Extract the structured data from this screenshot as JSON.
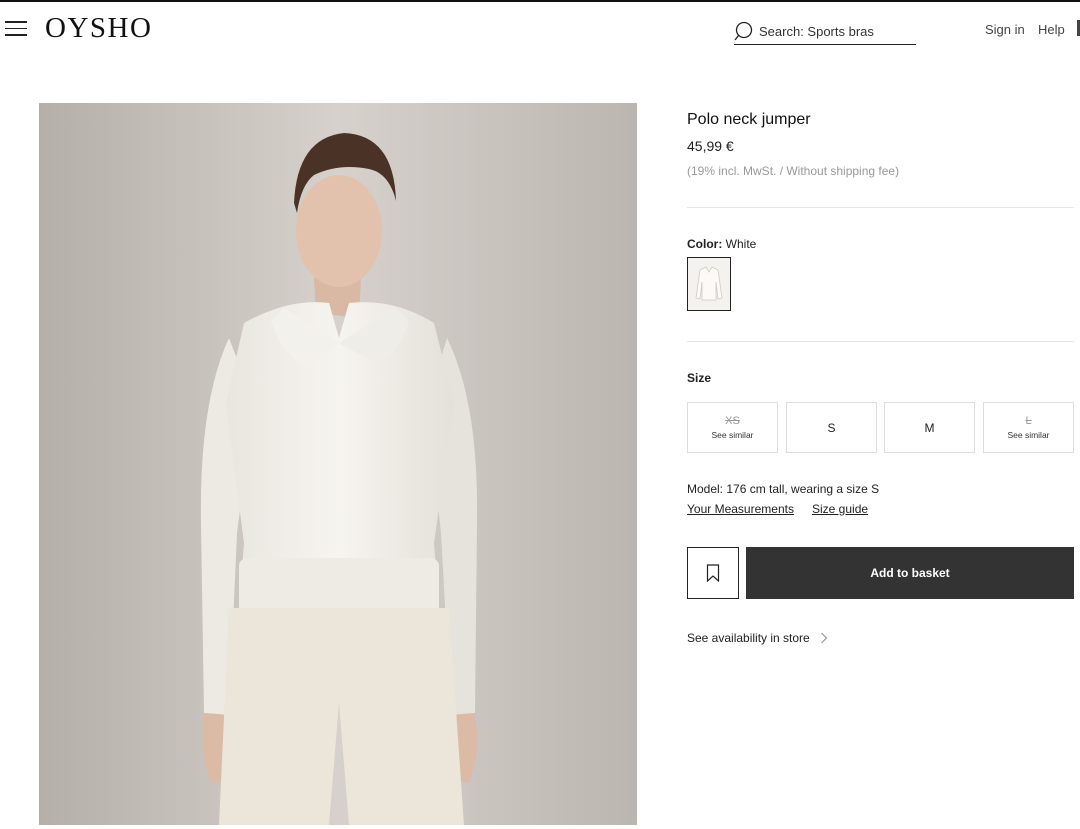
{
  "header": {
    "logo": "OYSHO",
    "search_label": "Search: Sports bras",
    "signin": "Sign in",
    "help": "Help"
  },
  "product": {
    "title": "Polo neck jumper",
    "price": "45,99 €",
    "tax_note": "(19% incl. MwSt. / Without shipping fee)",
    "color_label": "Color:",
    "color_value": "White",
    "size_label": "Size",
    "sizes": [
      {
        "label": "XS",
        "available": false,
        "note": "See similar"
      },
      {
        "label": "S",
        "available": true,
        "note": ""
      },
      {
        "label": "M",
        "available": true,
        "note": ""
      },
      {
        "label": "L",
        "available": false,
        "note": "See similar"
      }
    ],
    "model_info": "Model: 176 cm tall, wearing a size S",
    "your_measurements": "Your Measurements",
    "size_guide": "Size guide",
    "add_to_basket": "Add to basket",
    "availability": "See availability in store"
  },
  "icons": {
    "menu": "menu-icon",
    "search": "search-icon",
    "bookmark": "bookmark-icon",
    "chevron": "chevron-right-icon"
  },
  "colors": {
    "button_bg": "#333333",
    "divider": "#e6e6e6",
    "muted_text": "#999999"
  }
}
